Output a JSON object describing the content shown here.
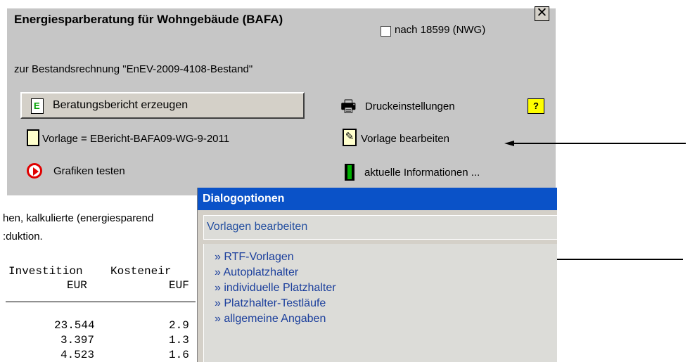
{
  "dialog": {
    "title": "Energiesparberatung für Wohngebäude (BAFA)",
    "close_glyph": "✕",
    "nwg_checkbox_label": "nach 18599 (NWG)",
    "nwg_checked": false,
    "subtitle": "zur Bestandsrechnung \"EnEV-2009-4108-Bestand\"",
    "report_button_label": "Beratungsbericht erzeugen",
    "print_settings_label": "Druckeinstellungen",
    "template_label": "Vorlage = EBericht-BAFA09-WG-9-2011",
    "edit_template_label": "Vorlage bearbeiten",
    "test_graphics_label": "Grafiken testen",
    "info_label": "aktuelle Informationen ..."
  },
  "background": {
    "line1": "hen, kalkulierte (energiesparend",
    "line2": ":duktion.",
    "col1_header1": "Investition",
    "col1_header2": "EUR",
    "col2_header1": "Kosteneir",
    "col2_header2": "EUF",
    "rows": [
      {
        "c1": "23.544",
        "c2": "2.9"
      },
      {
        "c1": "3.397",
        "c2": "1.3"
      },
      {
        "c1": "4.523",
        "c2": "1.6"
      }
    ]
  },
  "overlay": {
    "title": "Dialogoptionen",
    "section": "Vorlagen bearbeiten",
    "items": [
      "» RTF-Vorlagen",
      "» Autoplatzhalter",
      "» individuelle Platzhalter",
      "» Platzhalter-Testläufe",
      "» allgemeine Angaben"
    ]
  },
  "icons": [
    "report-icon",
    "printer-icon",
    "help-book-icon",
    "document-icon",
    "edit-document-icon",
    "chart-icon",
    "info-icon",
    "arrow-left-icon"
  ]
}
